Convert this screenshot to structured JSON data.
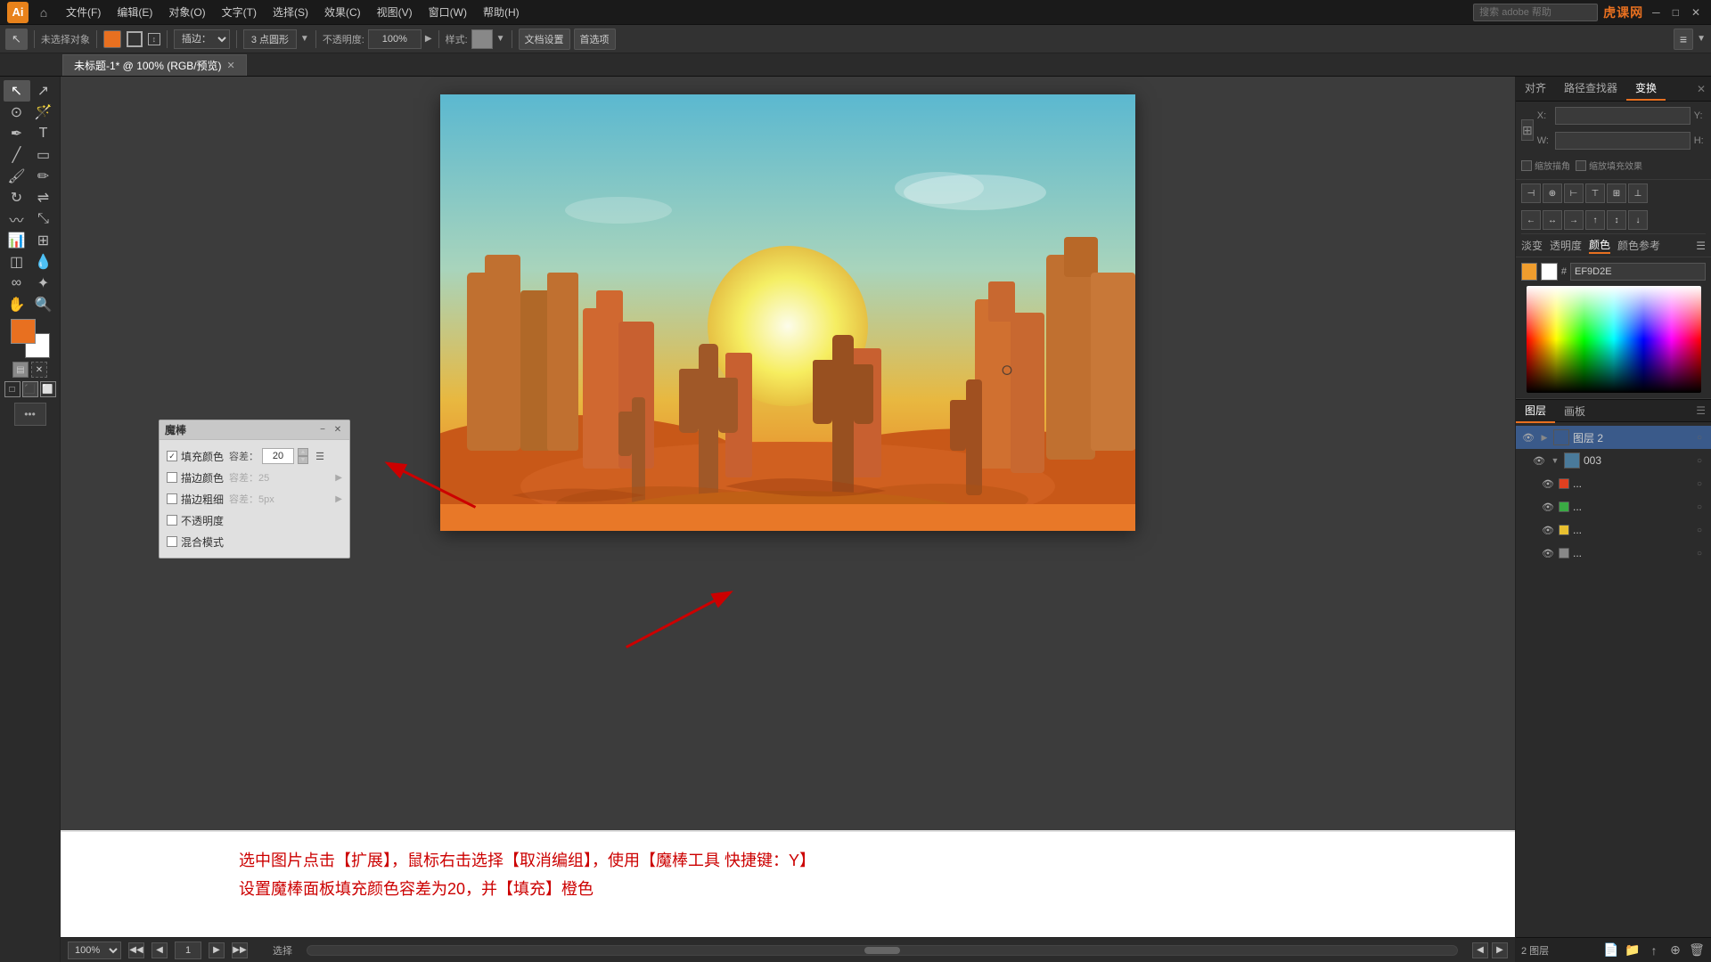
{
  "app": {
    "title": "Adobe Illustrator",
    "logo": "Ai",
    "watermark": "虎课网"
  },
  "menubar": {
    "items": [
      "文件(F)",
      "编辑(E)",
      "对象(O)",
      "文字(T)",
      "选择(S)",
      "效果(C)",
      "视图(V)",
      "窗口(W)",
      "帮助(H)"
    ]
  },
  "toolbar": {
    "fill_label": "填充:",
    "stroke_label": "描边:",
    "tool_label": "描边:",
    "brush_label": "插边：",
    "point_label": "3 点圆形",
    "opacity_label": "不透明度: 100%",
    "style_label": "样式:",
    "doc_settings": "文档设置",
    "preferences": "首选项"
  },
  "tabs": [
    {
      "name": "未标题-1*",
      "detail": "100% (RGB/预览)",
      "active": true
    }
  ],
  "magic_wand_panel": {
    "title": "魔棒",
    "fill_color_label": "填充颜色",
    "fill_color_checked": true,
    "tolerance_label": "容差：",
    "tolerance_value": "20",
    "stroke_color_label": "描边颜色",
    "stroke_color_checked": false,
    "stroke_color_tolerance": "容差：25",
    "stroke_width_label": "描边粗细",
    "stroke_width_checked": false,
    "stroke_width_tolerance": "容差：5px",
    "opacity_label": "不透明度",
    "opacity_checked": false,
    "blend_mode_label": "混合模式",
    "blend_mode_checked": false
  },
  "instruction": {
    "line1": "选中图片点击【扩展】，鼠标右击选择【取消编组】，使用【魔棒工具 快捷键：Y】",
    "line2": "设置魔棒面板填充颜色容差为20，并【填充】橙色"
  },
  "right_panel": {
    "tabs": [
      "对齐",
      "路径查找器",
      "变换"
    ],
    "active_tab": "变换",
    "transform": {
      "x_label": "X:",
      "x_value": "",
      "y_label": "Y:",
      "y_value": "",
      "w_label": "W:",
      "w_value": "",
      "h_label": "H:",
      "h_value": ""
    },
    "color_section": {
      "hex_label": "#",
      "hex_value": "EF9D2E",
      "tabs": [
        "淡变",
        "透明度",
        "颜色",
        "颜色参考"
      ]
    }
  },
  "layers_panel": {
    "tabs": [
      "图层",
      "画板"
    ],
    "active_tab": "图层",
    "layers": [
      {
        "name": "图层 2",
        "expanded": true,
        "visible": true,
        "locked": false,
        "active": true,
        "color": "#3a7fc1"
      },
      {
        "name": "003",
        "indent": true,
        "visible": true,
        "locked": false,
        "color": "#3a7fc1"
      },
      {
        "name": "...",
        "indent": true,
        "visible": true,
        "locked": false,
        "color": "#e04020"
      },
      {
        "name": "...",
        "indent": true,
        "visible": true,
        "locked": false,
        "color": "#3aaa44"
      },
      {
        "name": "...",
        "indent": true,
        "visible": true,
        "locked": false,
        "color": "#e8c030"
      },
      {
        "name": "...",
        "indent": true,
        "visible": true,
        "locked": false,
        "color": "#888888"
      }
    ],
    "bottom_label": "2 图层"
  },
  "bottom_bar": {
    "zoom": "100%",
    "page": "1",
    "status": "选择"
  },
  "colors": {
    "accent": "#e87020",
    "background": "#2b2b2b",
    "panel_bg": "#e0e0e0"
  }
}
